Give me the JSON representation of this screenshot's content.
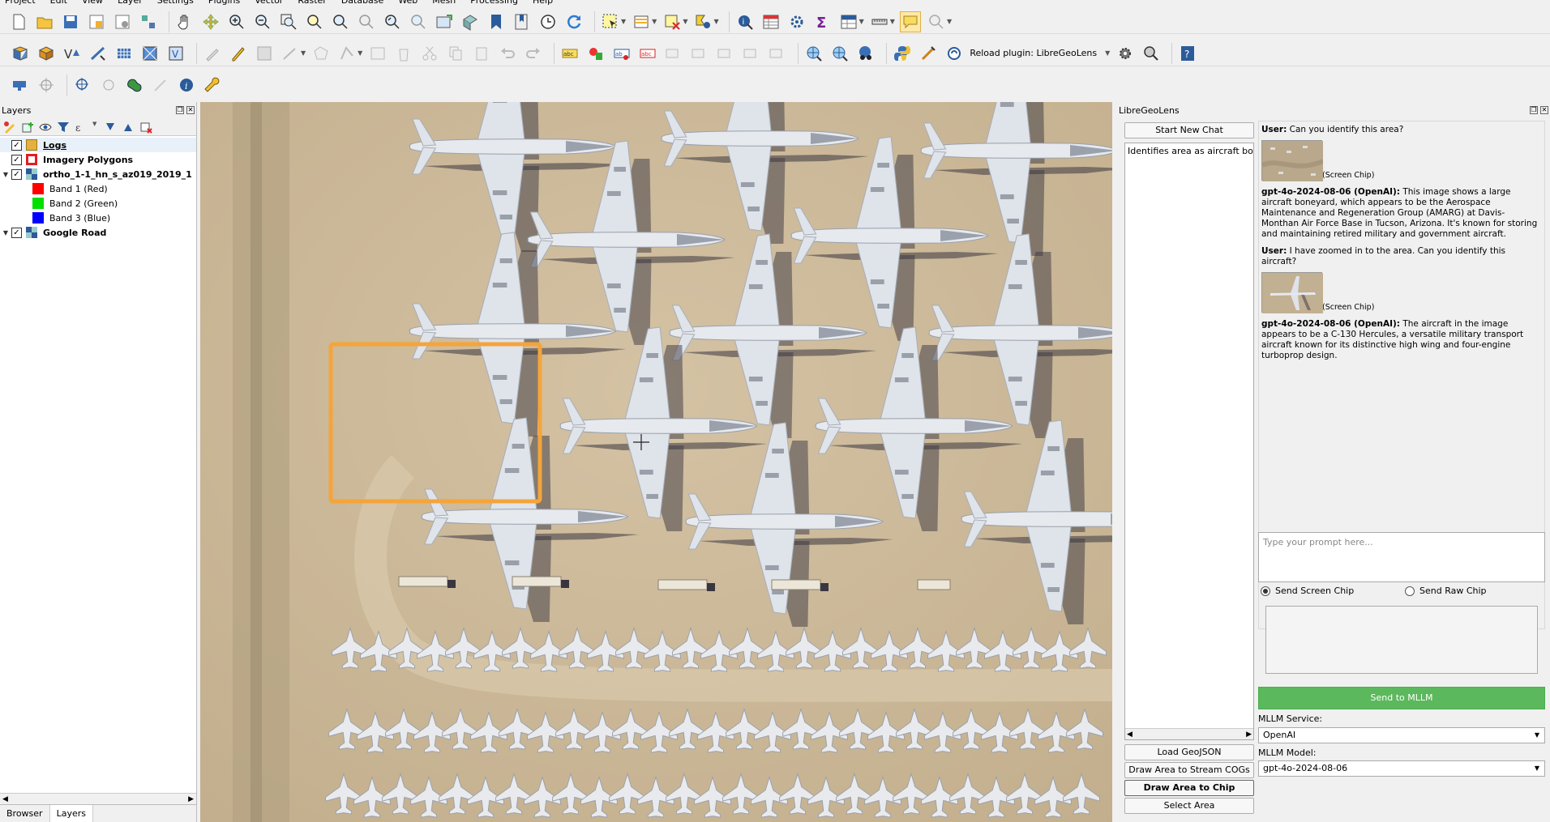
{
  "menu": [
    "Project",
    "Edit",
    "View",
    "Layer",
    "Settings",
    "Plugins",
    "Vector",
    "Raster",
    "Database",
    "Web",
    "Mesh",
    "Processing",
    "Help"
  ],
  "toolbar": {
    "reload_plugin_label": "Reload plugin: LibreGeoLens"
  },
  "layers_panel": {
    "title": "Layers",
    "items": [
      {
        "label": "Logs",
        "checked": true,
        "swatch": "#e3b041"
      },
      {
        "label": "Imagery Polygons",
        "checked": true,
        "swatch": "#e02020"
      },
      {
        "label": "ortho_1-1_hn_s_az019_2019_1",
        "checked": true
      },
      {
        "label": "Band 1 (Red)",
        "swatch": "#ff0000"
      },
      {
        "label": "Band 2 (Green)",
        "swatch": "#00e000"
      },
      {
        "label": "Band 3 (Blue)",
        "swatch": "#0000ff"
      },
      {
        "label": "Google Road",
        "checked": true
      }
    ]
  },
  "bottom_tabs": [
    "Browser",
    "Layers"
  ],
  "plugin": {
    "title": "LibreGeoLens",
    "start_new_chat": "Start New Chat",
    "history_item": "Identifies area as aircraft boneyard",
    "load_geojson": "Load GeoJSON",
    "draw_stream": "Draw Area to Stream COGs",
    "draw_chip": "Draw Area to Chip Imagery",
    "select_area": "Select Area",
    "messages": [
      {
        "speaker": "User:",
        "text": "Can you identify this area?",
        "chip": "(Screen Chip)"
      },
      {
        "speaker": "gpt-4o-2024-08-06 (OpenAI):",
        "text": "This image shows a large aircraft boneyard, which appears to be the Aerospace Maintenance and Regeneration Group (AMARG) at Davis-Monthan Air Force Base in Tucson, Arizona. It's known for storing and maintaining retired military and government aircraft."
      },
      {
        "speaker": "User:",
        "text": "I have zoomed in to the area. Can you identify this aircraft?",
        "chip": "(Screen Chip)"
      },
      {
        "speaker": "gpt-4o-2024-08-06 (OpenAI):",
        "text": "The aircraft in the image appears to be a C-130 Hercules, a versatile military transport aircraft known for its distinctive high wing and four-engine turboprop design."
      }
    ],
    "prompt_placeholder": "Type your prompt here...",
    "send_screen_chip": "Send Screen Chip",
    "send_raw_chip": "Send Raw Chip",
    "send_button": "Send to MLLM",
    "service_label": "MLLM Service:",
    "service_value": "OpenAI",
    "model_label": "MLLM Model:",
    "model_value": "gpt-4o-2024-08-06"
  },
  "colors": {
    "accent": "#5cb85c",
    "highlight": "#f5a43a",
    "ground": "#c9b596"
  }
}
